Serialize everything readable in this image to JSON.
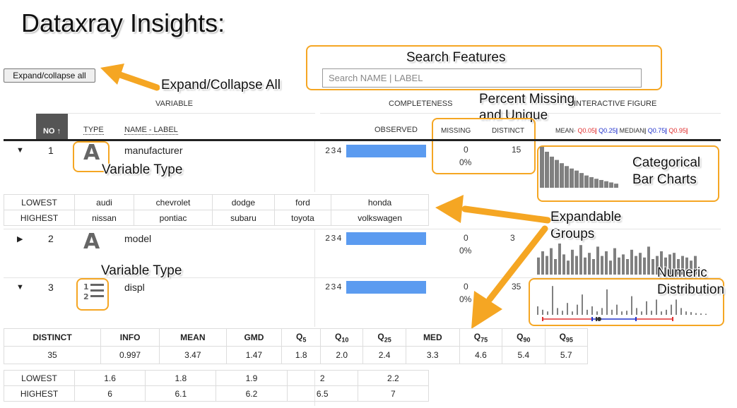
{
  "page_title": "Dataxray Insights:",
  "toolbar": {
    "expand_label": "Expand/collapse all"
  },
  "search": {
    "placeholder": "Search NAME | LABEL"
  },
  "headers": {
    "variable": "VARIABLE",
    "completeness": "COMPLETENESS",
    "interactive_figure": "INTERACTIVE FIGURE",
    "no": "NO",
    "no_sort": "↑",
    "type": "TYPE",
    "name_label": "NAME - LABEL",
    "observed": "OBSERVED",
    "missing": "MISSING",
    "distinct": "DISTINCT",
    "legend": {
      "mean": "MEAN·",
      "q05": "Q0.05",
      "q25": "Q0.25",
      "median": "MEDIAN",
      "q75": "Q0.75",
      "q95": "Q0.95"
    }
  },
  "rows": [
    {
      "no": "1",
      "type_icon": "categorical-type-icon",
      "name": "manufacturer",
      "observed": "234",
      "missing": "0",
      "missing_pct": "0%",
      "distinct": "15",
      "expanded": true
    },
    {
      "no": "2",
      "type_icon": "categorical-type-icon",
      "name": "model",
      "observed": "234",
      "missing": "0",
      "missing_pct": "0%",
      "distinct": "3",
      "expanded": false
    },
    {
      "no": "3",
      "type_icon": "numeric-type-icon",
      "name": "displ",
      "observed": "234",
      "missing": "0",
      "missing_pct": "0%",
      "distinct": "35",
      "expanded": true
    }
  ],
  "manufacturer_extremes": {
    "lowest_label": "LOWEST",
    "highest_label": "HIGHEST",
    "lowest": [
      "audi",
      "chevrolet",
      "dodge",
      "ford",
      "honda"
    ],
    "highest": [
      "nissan",
      "pontiac",
      "subaru",
      "toyota",
      "volkswagen"
    ]
  },
  "displ_stats": {
    "headers": [
      "DISTINCT",
      "INFO",
      "MEAN",
      "GMD",
      "Q",
      "Q",
      "Q",
      "MED",
      "Q",
      "Q",
      "Q"
    ],
    "subscripts": [
      "",
      "",
      "",
      "",
      "5",
      "10",
      "25",
      "",
      "75",
      "90",
      "95"
    ],
    "values": [
      "35",
      "0.997",
      "3.47",
      "1.47",
      "1.8",
      "2.0",
      "2.4",
      "3.3",
      "4.6",
      "5.4",
      "5.7"
    ]
  },
  "displ_extremes": {
    "lowest_label": "LOWEST",
    "highest_label": "HIGHEST",
    "lowest": [
      "1.6",
      "1.8",
      "1.9",
      "2",
      "2.2"
    ],
    "highest": [
      "6",
      "6.1",
      "6.2",
      "6.5",
      "7"
    ]
  },
  "charts": {
    "manufacturer_bars": [
      1.0,
      0.88,
      0.76,
      0.68,
      0.6,
      0.53,
      0.47,
      0.42,
      0.36,
      0.3,
      0.26,
      0.22,
      0.19,
      0.16,
      0.13,
      0.1
    ],
    "model_bars": [
      0.55,
      0.75,
      0.6,
      0.85,
      0.5,
      1.0,
      0.65,
      0.45,
      0.8,
      0.6,
      0.95,
      0.55,
      0.7,
      0.5,
      0.9,
      0.6,
      0.75,
      0.45,
      0.85,
      0.55,
      0.65,
      0.5,
      0.8,
      0.6,
      0.7,
      0.55,
      0.9,
      0.5,
      0.6,
      0.75,
      0.55,
      0.65,
      0.7,
      0.5,
      0.6,
      0.55,
      0.45,
      0.6
    ],
    "displ_spikes": [
      0.25,
      0.15,
      0.1,
      0.85,
      0.2,
      0.12,
      0.35,
      0.1,
      0.3,
      0.6,
      0.15,
      0.25,
      0.1,
      0.2,
      0.75,
      0.15,
      0.3,
      0.1,
      0.12,
      0.55,
      0.2,
      0.1,
      0.4,
      0.12,
      0.45,
      0.1,
      0.15,
      0.3,
      0.45,
      0.2,
      0.1,
      0.08,
      0.05,
      0.04,
      0.03
    ],
    "colors": {
      "bar": "#808080",
      "range_red": "#e03030",
      "range_blue": "#2233cc",
      "median": "#333333",
      "observed": "#5b9bf0",
      "accent": "#f5a623"
    }
  },
  "annotations": {
    "search_features": "Search Features",
    "expand_collapse_all": "Expand/Collapse All",
    "percent_missing_line1": "Percent Missing",
    "percent_missing_line2": "and Unique",
    "variable_type_1": "Variable Type",
    "variable_type_2": "Variable Type",
    "categorical_line1": "Categorical",
    "categorical_line2": "Bar Charts",
    "expandable_line1": "Expandable",
    "expandable_line2": "Groups",
    "numeric_line1": "Numeric",
    "numeric_line2": "Distribution"
  }
}
